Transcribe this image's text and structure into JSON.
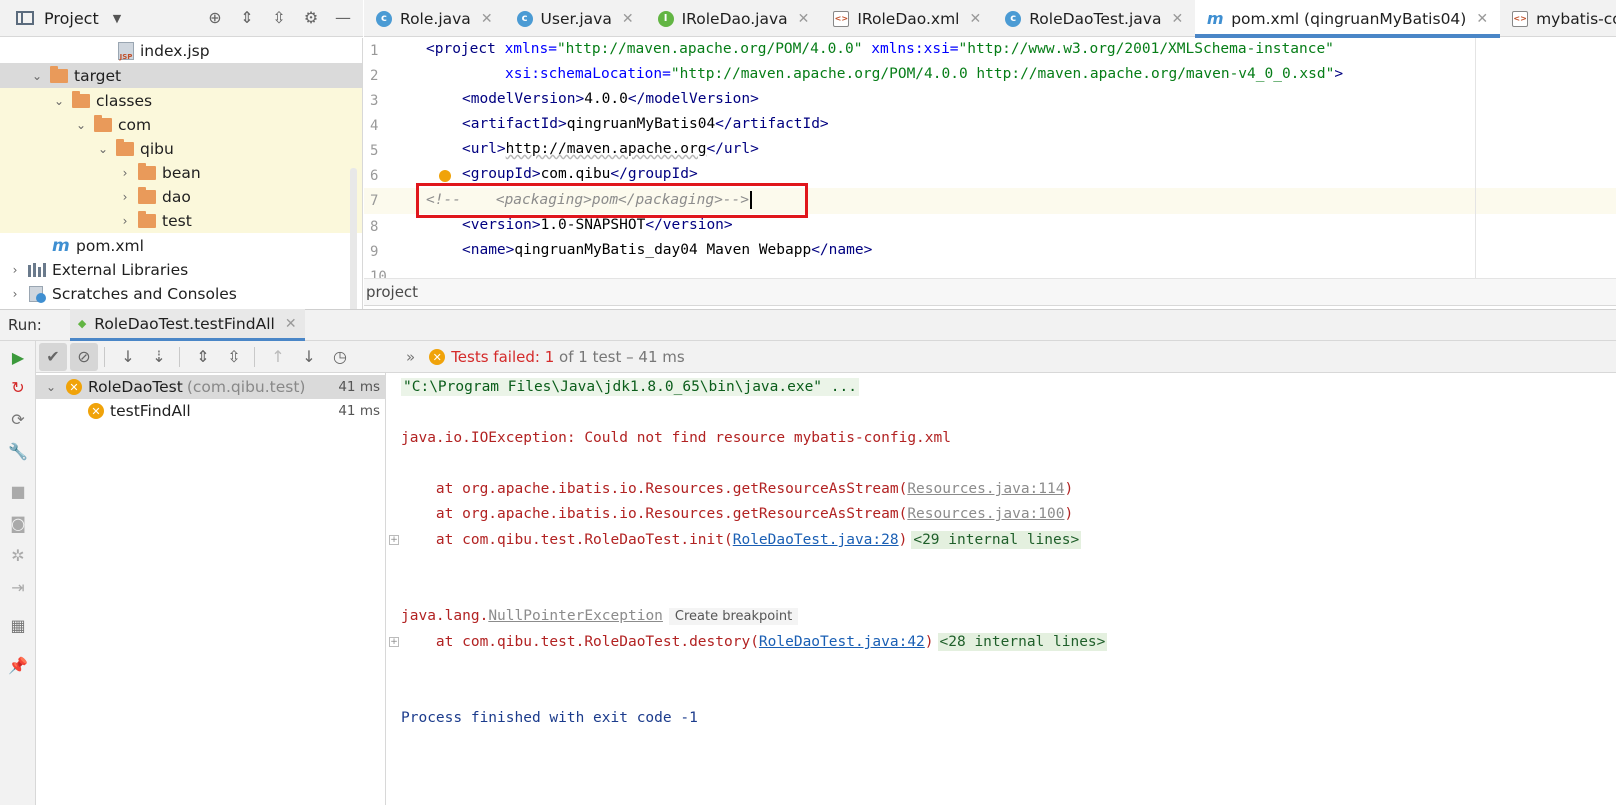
{
  "project_panel": {
    "title": "Project",
    "tree": [
      {
        "label": "index.jsp",
        "icon": "jsp-file-icon",
        "indent": 118,
        "expanded": null
      },
      {
        "label": "target",
        "icon": "folder-icon",
        "indent": 52,
        "expanded": true
      },
      {
        "label": "classes",
        "icon": "folder-icon",
        "indent": 74,
        "expanded": true
      },
      {
        "label": "com",
        "icon": "folder-icon",
        "indent": 96,
        "expanded": true
      },
      {
        "label": "qibu",
        "icon": "folder-icon",
        "indent": 118,
        "expanded": true
      },
      {
        "label": "bean",
        "icon": "folder-icon",
        "indent": 140,
        "expanded": false
      },
      {
        "label": "dao",
        "icon": "folder-icon",
        "indent": 140,
        "expanded": false
      },
      {
        "label": "test",
        "icon": "folder-icon",
        "indent": 140,
        "expanded": false
      },
      {
        "label": "pom.xml",
        "icon": "maven-icon",
        "indent": 52,
        "expanded": null
      },
      {
        "label": "External Libraries",
        "icon": "library-icon",
        "indent": 30,
        "expanded": false
      },
      {
        "label": "Scratches and Consoles",
        "icon": "scratch-icon",
        "indent": 30,
        "expanded": false
      }
    ]
  },
  "editor_tabs": [
    {
      "label": "Role.java",
      "type": "class"
    },
    {
      "label": "User.java",
      "type": "class"
    },
    {
      "label": "IRoleDao.java",
      "type": "iface"
    },
    {
      "label": "IRoleDao.xml",
      "type": "xml"
    },
    {
      "label": "RoleDaoTest.java",
      "type": "test"
    },
    {
      "label": "pom.xml (qingruanMyBatis04)",
      "type": "maven",
      "active": true
    },
    {
      "label": "mybatis-config.xml",
      "type": "xml"
    }
  ],
  "editor": {
    "line_numbers": [
      "1",
      "2",
      "3",
      "4",
      "5",
      "6",
      "7",
      "8",
      "9",
      "10"
    ],
    "l1_tag_open": "<project",
    "l1_attr1": " xmlns=",
    "l1_val1": "\"http://maven.apache.org/POM/4.0.0\"",
    "l1_attr2": " xmlns:xsi=",
    "l1_val2": "\"http://www.w3.org/2001/XMLSchema-instance\"",
    "l2_attr": "xsi:schemaLocation=",
    "l2_val": "\"http://maven.apache.org/POM/4.0.0 http://maven.apache.org/maven-v4_0_0.xsd\"",
    "l2_close": ">",
    "l3_open": "<modelVersion>",
    "l3_text": "4.0.0",
    "l3_close": "</modelVersion>",
    "l4_open": "<artifactId>",
    "l4_text": "qingruanMyBatis04",
    "l4_close": "</artifactId>",
    "l5_open": "<url>",
    "l5_text": "http://maven.apache.org",
    "l5_close": "</url>",
    "l6_open": "<groupId>",
    "l6_text": "com.qibu",
    "l6_close": "</groupId>",
    "l7_comment": "<!--    <packaging>pom</packaging>-->",
    "l8_open": "<version>",
    "l8_text": "1.0-SNAPSHOT",
    "l8_close": "</version>",
    "l9_open": "<name>",
    "l9_text": "qingruanMyBatis_day04 Maven Webapp",
    "l9_close": "</name>"
  },
  "breadcrumb": "project",
  "run": {
    "label": "Run:",
    "tab": "RoleDaoTest.testFindAll",
    "status_prefix": "Tests failed:",
    "status_count": "1",
    "status_suffix": "of 1 test – 41 ms",
    "tree": [
      {
        "name": "RoleDaoTest",
        "pkg": "(com.qibu.test)",
        "time": "41 ms"
      },
      {
        "name": "testFindAll",
        "pkg": "",
        "time": "41 ms"
      }
    ]
  },
  "console": {
    "cmd": "\"C:\\Program Files\\Java\\jdk1.8.0_65\\bin\\java.exe\" ...",
    "ex1": "java.io.IOException: Could not find resource mybatis-config.xml",
    "st1_pre": "    at org.apache.ibatis.io.Resources.getResourceAsStream(",
    "st1_link": "Resources.java:114",
    "st2_pre": "    at org.apache.ibatis.io.Resources.getResourceAsStream(",
    "st2_link": "Resources.java:100",
    "st3_pre": "    at com.qibu.test.RoleDaoTest.init(",
    "st3_link": "RoleDaoTest.java:28",
    "st3_internal": "<29 internal lines>",
    "ex2_pre": "java.lang.",
    "ex2_link": "NullPointerException",
    "ex2_hint": "Create breakpoint",
    "st4_pre": "    at com.qibu.test.RoleDaoTest.destory(",
    "st4_link": "RoleDaoTest.java:42",
    "st4_internal": "<28 internal lines>",
    "exit": "Process finished with exit code -1",
    "close_paren": ")"
  }
}
